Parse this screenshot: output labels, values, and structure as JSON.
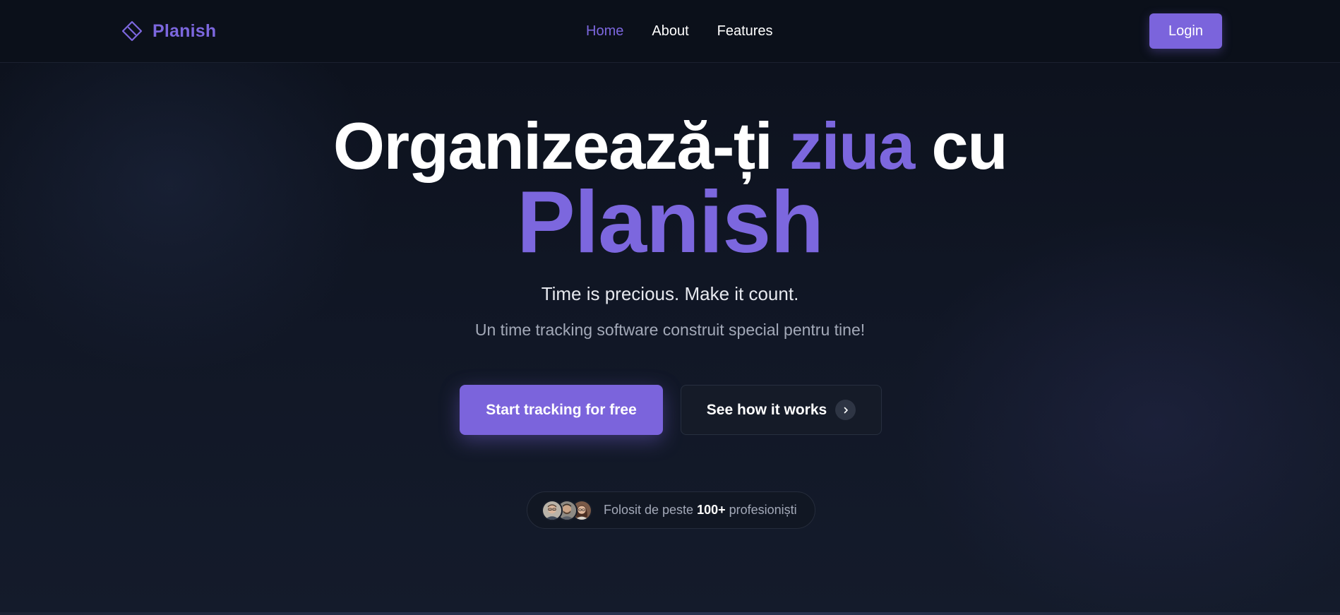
{
  "brand": {
    "name": "Planish",
    "icon": "diamond-logo-icon",
    "accent_color": "#7c67de"
  },
  "nav": {
    "items": [
      {
        "label": "Home",
        "active": true
      },
      {
        "label": "About",
        "active": false
      },
      {
        "label": "Features",
        "active": false
      }
    ],
    "login_label": "Login"
  },
  "hero": {
    "title_part1": "Organizează-ți ",
    "title_accent": "ziua",
    "title_part2": " cu",
    "title_brand": "Planish",
    "tagline": "Time is precious. Make it count.",
    "subtagline": "Un time tracking software construit special pentru tine!"
  },
  "cta": {
    "primary_label": "Start tracking for free",
    "secondary_label": "See how it works",
    "secondary_icon": "chevron-right-icon"
  },
  "social_proof": {
    "prefix": "Folosit de peste ",
    "count": "100+",
    "suffix": " profesioniști",
    "avatars": [
      "avatar-man-glasses",
      "avatar-man-beard",
      "avatar-woman"
    ]
  },
  "colors": {
    "background": "#0f1420",
    "navbar": "#0b101a",
    "primary": "#7b64dc",
    "text_muted": "#a3a9b8"
  }
}
